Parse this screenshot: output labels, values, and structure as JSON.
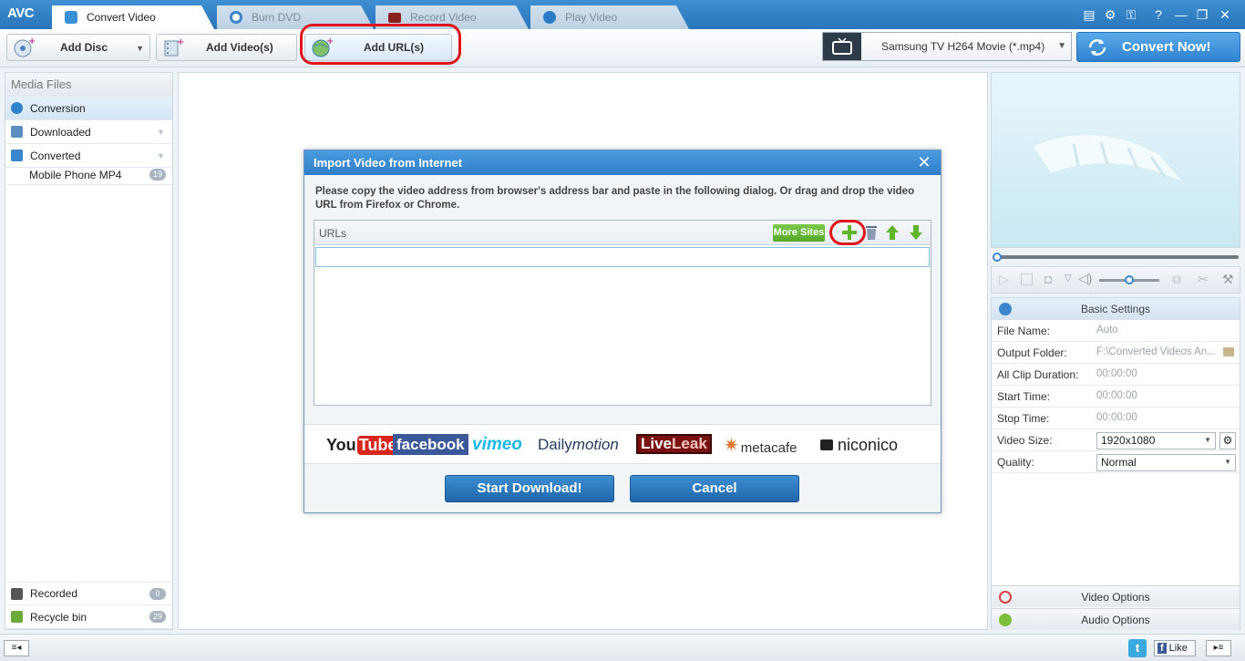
{
  "app": {
    "logo": "AVC"
  },
  "tabs": [
    {
      "label": "Convert Video",
      "active": true
    },
    {
      "label": "Burn DVD",
      "active": false
    },
    {
      "label": "Record Video",
      "active": false
    },
    {
      "label": "Play Video",
      "active": false
    }
  ],
  "toolbar": {
    "add_disc": "Add Disc",
    "add_videos": "Add Video(s)",
    "add_urls": "Add URL(s)",
    "profile": "Samsung TV H264 Movie (*.mp4)",
    "convert_now": "Convert Now!"
  },
  "sidebar": {
    "title": "Media Files",
    "items": [
      {
        "label": "Conversion"
      },
      {
        "label": "Downloaded"
      },
      {
        "label": "Converted"
      },
      {
        "label": "Mobile Phone MP4",
        "count": "19"
      }
    ],
    "bottom": [
      {
        "label": "Recorded",
        "count": "0"
      },
      {
        "label": "Recycle bin",
        "count": "29"
      }
    ]
  },
  "dialog": {
    "title": "Import Video from Internet",
    "instructions": "Please copy the video address from browser's address bar and paste in the following dialog. Or drag and drop the video URL from Firefox or Chrome.",
    "urls_header": "URLs",
    "more_sites": "More Sites",
    "url_value": "",
    "sites": {
      "youtube_a": "You",
      "youtube_b": "Tube",
      "facebook": "facebook",
      "vimeo": "vimeo",
      "dailymotion_a": "Daily",
      "dailymotion_b": "motion",
      "liveleak_a": "Live",
      "liveleak_b": "Leak",
      "metacafe": "metacafe",
      "niconico": "niconico"
    },
    "start_download": "Start Download!",
    "cancel": "Cancel"
  },
  "settings": {
    "header": "Basic Settings",
    "rows": [
      {
        "label": "File Name:",
        "value": "Auto"
      },
      {
        "label": "Output Folder:",
        "value": "F:\\Converted Videos An..."
      },
      {
        "label": "All Clip Duration:",
        "value": "00:00:00"
      },
      {
        "label": "Start Time:",
        "value": "00:00:00"
      },
      {
        "label": "Stop Time:",
        "value": "00:00:00"
      },
      {
        "label": "Video Size:",
        "value": "1920x1080"
      },
      {
        "label": "Quality:",
        "value": "Normal"
      }
    ],
    "video_options": "Video Options",
    "audio_options": "Audio Options"
  },
  "statusbar": {
    "like": "Like"
  },
  "colors": {
    "accent": "#2f7ec8",
    "highlight_ring": "#e0141b",
    "more_sites": "#55a928"
  }
}
